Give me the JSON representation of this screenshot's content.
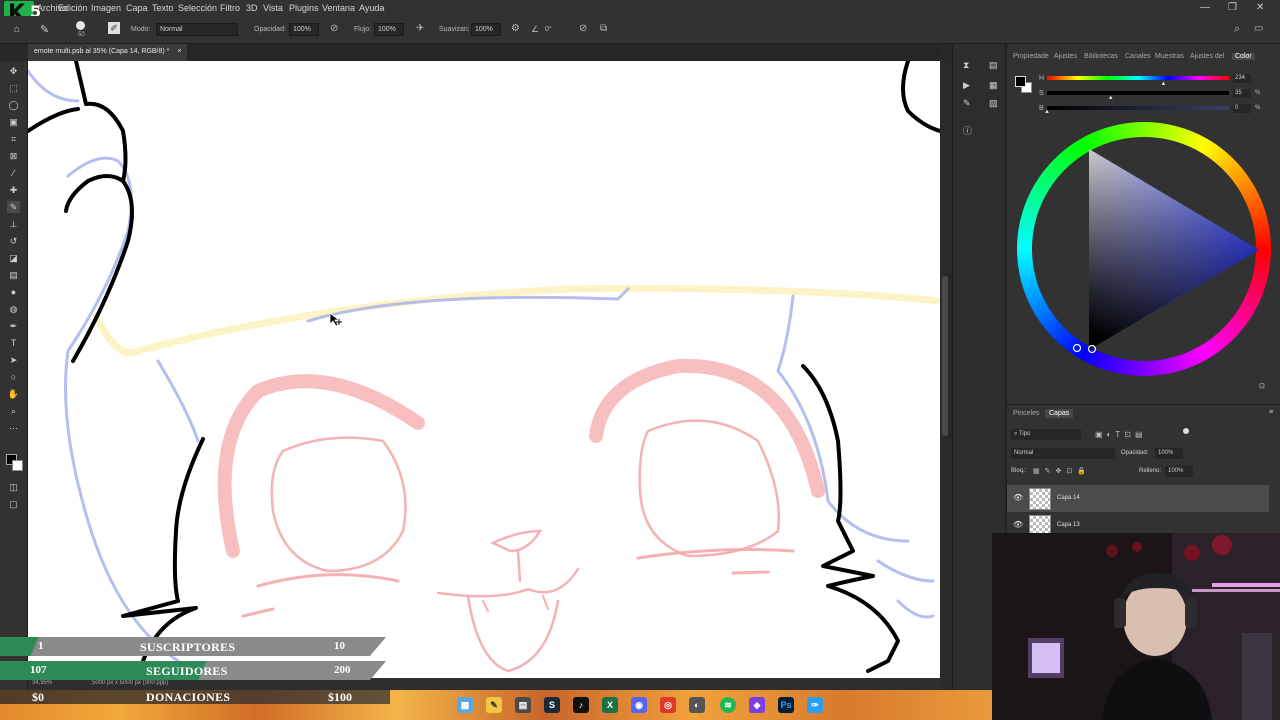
{
  "menu": {
    "items": [
      "Archivo",
      "Edición",
      "Imagen",
      "Capa",
      "Texto",
      "Selección",
      "Filtro",
      "3D",
      "Vista",
      "Plugins",
      "Ventana",
      "Ayuda"
    ],
    "logo_letter": "K",
    "logo_number": "5"
  },
  "options": {
    "brush_size": "50",
    "mode_label": "Modo:",
    "mode_value": "Normal",
    "opacity_label": "Opacidad:",
    "opacity_value": "100%",
    "flow_label": "Flujo:",
    "flow_value": "100%",
    "smoothing_label": "Suavizan:",
    "smoothing_value": "100%",
    "angle_value": "0°"
  },
  "document": {
    "tab_title": "emote multi.psb al 35% (Capa 14, RGB/8) *",
    "tab_close": "×",
    "zoom_status": "34,95%",
    "size_status": "5000 px x 5000 px (300 ppp)"
  },
  "panels": {
    "top_tabs": [
      "Propiedade",
      "Ajustes",
      "Bibliotecas",
      "Canales",
      "Muestras",
      "Ajustes del",
      "Color"
    ],
    "active_top_tab": "Color",
    "hsb": {
      "h_label": "H",
      "h_value": "234",
      "h_fraction": 0.64,
      "s_label": "S",
      "s_value": "35",
      "s_fraction": 0.35,
      "b_label": "B",
      "b_value": "0",
      "b_fraction": 0.0,
      "pct": "%"
    },
    "layer_tabs": [
      "Pinceles",
      "Capas"
    ],
    "active_layer_tab": "Capas",
    "kind_filter": "Tipo",
    "blend_mode": "Normal",
    "opacity_label": "Opacidad:",
    "opacity_value": "100%",
    "lock_label": "Bloq.:",
    "fill_label": "Relleno:",
    "fill_value": "100%",
    "layers": [
      {
        "name": "Capa 14",
        "selected": true
      },
      {
        "name": "Capa 13",
        "selected": false
      }
    ]
  },
  "stream_overlay": {
    "subs_current": "1",
    "subs_label": "SUSCRIPTORES",
    "subs_goal": "10",
    "subs_fraction": 0.1,
    "followers_current": "107",
    "followers_label": "SEGUIDORES",
    "followers_goal": "200",
    "followers_fraction": 0.535,
    "donations_current": "$0",
    "donations_label": "DONACIONES",
    "donations_goal": "$100"
  },
  "taskbar": {
    "icons": [
      "file-explorer-icon",
      "sticky-notes-icon",
      "calculator-icon",
      "steam-icon",
      "tiktok-icon",
      "excel-icon",
      "discord-icon",
      "chrome-icon",
      "spotify-icon",
      "cursor-app-icon",
      "photoshop-icon",
      "pen-tablet-icon"
    ]
  },
  "colors": {
    "foreground": "#000000",
    "background": "#ffffff",
    "canvas_pink": "#f4a9ab",
    "canvas_blue": "#a9b3ee",
    "canvas_yellow": "#fbf0b8",
    "overlay_green": "#2e8b57",
    "overlay_gray": "#8a8a8a"
  }
}
